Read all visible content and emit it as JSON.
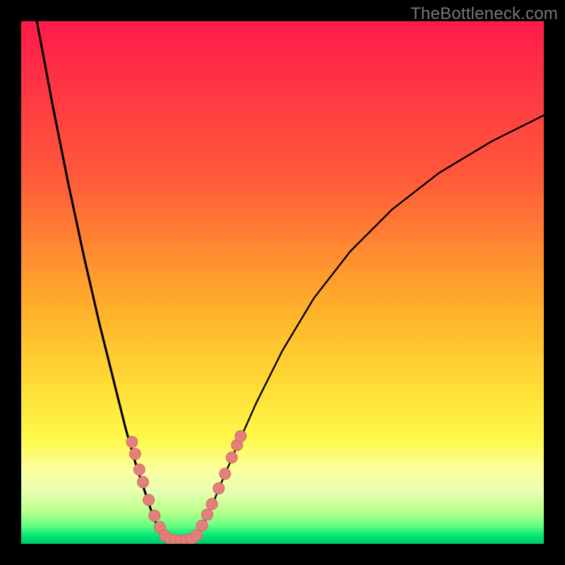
{
  "watermark": "TheBottleneck.com",
  "colors": {
    "frame": "#000000",
    "curve": "#000000",
    "point_fill": "#e3807c",
    "point_stroke": "#d06a66",
    "gradient_stops": [
      {
        "offset": 0.0,
        "color": "#ff1a4b"
      },
      {
        "offset": 0.3,
        "color": "#ff5a3a"
      },
      {
        "offset": 0.55,
        "color": "#ffb02a"
      },
      {
        "offset": 0.72,
        "color": "#ffe338"
      },
      {
        "offset": 0.8,
        "color": "#fff94a"
      },
      {
        "offset": 0.86,
        "color": "#fbffa0"
      },
      {
        "offset": 0.9,
        "color": "#e8ffb0"
      },
      {
        "offset": 0.94,
        "color": "#b7ff8c"
      },
      {
        "offset": 0.965,
        "color": "#66ff80"
      },
      {
        "offset": 0.985,
        "color": "#00e676"
      },
      {
        "offset": 1.0,
        "color": "#00c96b"
      }
    ]
  },
  "chart_data": {
    "type": "line",
    "title": "",
    "xlabel": "",
    "ylabel": "",
    "xlim": [
      0,
      100
    ],
    "ylim": [
      0,
      100
    ],
    "series": [
      {
        "name": "bottleneck_curve_left",
        "x": [
          3,
          6,
          9,
          12,
          15,
          18,
          20,
          22,
          24,
          25,
          26,
          27,
          28
        ],
        "y": [
          100,
          84,
          69,
          55,
          42,
          30,
          22,
          15,
          9,
          6,
          3.5,
          1.5,
          0.5
        ]
      },
      {
        "name": "bottleneck_curve_right",
        "x": [
          33,
          34,
          36,
          38,
          41,
          45,
          50,
          56,
          63,
          71,
          80,
          90,
          100
        ],
        "y": [
          0.5,
          2,
          6,
          11,
          18,
          27,
          37,
          47,
          56,
          64,
          71,
          77,
          82
        ]
      },
      {
        "name": "bottleneck_curve_floor",
        "x": [
          28,
          29,
          30,
          31,
          32,
          33
        ],
        "y": [
          0.5,
          0.1,
          0.05,
          0.05,
          0.1,
          0.5
        ]
      }
    ],
    "points_left": [
      {
        "x": 21.2,
        "y": 19.5
      },
      {
        "x": 21.8,
        "y": 17.2
      },
      {
        "x": 22.6,
        "y": 14.2
      },
      {
        "x": 23.3,
        "y": 11.8
      },
      {
        "x": 24.4,
        "y": 8.4
      },
      {
        "x": 25.5,
        "y": 5.4
      },
      {
        "x": 26.5,
        "y": 3.2
      },
      {
        "x": 27.5,
        "y": 1.6
      }
    ],
    "points_right": [
      {
        "x": 33.5,
        "y": 1.6
      },
      {
        "x": 34.6,
        "y": 3.5
      },
      {
        "x": 35.6,
        "y": 5.6
      },
      {
        "x": 36.5,
        "y": 7.6
      },
      {
        "x": 37.8,
        "y": 10.6
      },
      {
        "x": 39.0,
        "y": 13.4
      },
      {
        "x": 40.3,
        "y": 16.5
      },
      {
        "x": 41.3,
        "y": 18.9
      },
      {
        "x": 42.0,
        "y": 20.6
      }
    ],
    "points_floor": [
      {
        "x": 28.5,
        "y": 0.9
      },
      {
        "x": 29.5,
        "y": 0.7
      },
      {
        "x": 30.5,
        "y": 0.65
      },
      {
        "x": 31.5,
        "y": 0.7
      },
      {
        "x": 32.5,
        "y": 0.9
      }
    ],
    "point_radius_px": 8
  }
}
